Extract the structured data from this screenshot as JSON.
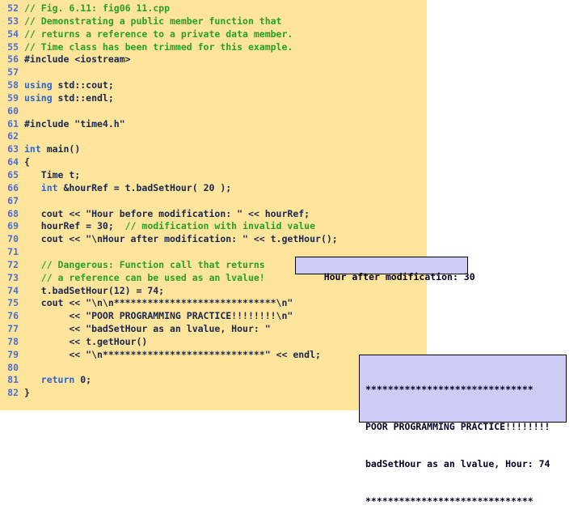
{
  "window": {
    "title": "C++ Code Listing - fig06_11.cpp",
    "background_color": "#ffffff"
  },
  "code_panel": {
    "background_color": "#ffe49b",
    "line_number_color": "#4a6fd4",
    "comment_color": "#27a122",
    "keyword_color": "#2b63d9",
    "plain_color": "#17264f",
    "first_line_number": 52,
    "last_line_number": 82,
    "lines": [
      {
        "n": "52",
        "segs": [
          {
            "t": "// Fig. 6.11: fig06 11.cpp",
            "c": "cm"
          }
        ]
      },
      {
        "n": "53",
        "segs": [
          {
            "t": "// Demonstrating a public member function that",
            "c": "cm"
          }
        ]
      },
      {
        "n": "54",
        "segs": [
          {
            "t": "// returns a reference to a private data member.",
            "c": "cm"
          }
        ]
      },
      {
        "n": "55",
        "segs": [
          {
            "t": "// Time class has been trimmed for this example.",
            "c": "cm"
          }
        ]
      },
      {
        "n": "56",
        "segs": [
          {
            "t": "#include <iostream>",
            "c": "pl"
          }
        ]
      },
      {
        "n": "57",
        "segs": [
          {
            "t": "",
            "c": "pl"
          }
        ]
      },
      {
        "n": "58",
        "segs": [
          {
            "t": "using",
            "c": "kw"
          },
          {
            "t": " std::cout;",
            "c": "pl"
          }
        ]
      },
      {
        "n": "59",
        "segs": [
          {
            "t": "using",
            "c": "kw"
          },
          {
            "t": " std::endl;",
            "c": "pl"
          }
        ]
      },
      {
        "n": "60",
        "segs": [
          {
            "t": "",
            "c": "pl"
          }
        ]
      },
      {
        "n": "61",
        "segs": [
          {
            "t": "#include \"time4.h\"",
            "c": "pl"
          }
        ]
      },
      {
        "n": "62",
        "segs": [
          {
            "t": "",
            "c": "pl"
          }
        ]
      },
      {
        "n": "63",
        "segs": [
          {
            "t": "int",
            "c": "kw"
          },
          {
            "t": " main()",
            "c": "pl"
          }
        ]
      },
      {
        "n": "64",
        "segs": [
          {
            "t": "{",
            "c": "pl"
          }
        ]
      },
      {
        "n": "65",
        "segs": [
          {
            "t": "   Time t;",
            "c": "pl"
          }
        ]
      },
      {
        "n": "66",
        "segs": [
          {
            "t": "   ",
            "c": "pl"
          },
          {
            "t": "int",
            "c": "kw"
          },
          {
            "t": " &hourRef = t.badSetHour( 20 );",
            "c": "pl"
          }
        ]
      },
      {
        "n": "67",
        "segs": [
          {
            "t": "",
            "c": "pl"
          }
        ]
      },
      {
        "n": "68",
        "segs": [
          {
            "t": "   cout << \"Hour before modification: \" << hourRef;",
            "c": "pl"
          }
        ]
      },
      {
        "n": "69",
        "segs": [
          {
            "t": "   hourRef = 30;  ",
            "c": "pl"
          },
          {
            "t": "// modification with invalid value",
            "c": "cm"
          }
        ]
      },
      {
        "n": "70",
        "segs": [
          {
            "t": "   cout << \"\\nHour after modification: \" << t.getHour();",
            "c": "pl"
          }
        ]
      },
      {
        "n": "71",
        "segs": [
          {
            "t": "",
            "c": "pl"
          }
        ]
      },
      {
        "n": "72",
        "segs": [
          {
            "t": "   ",
            "c": "pl"
          },
          {
            "t": "// Dangerous: Function call that returns",
            "c": "cm"
          }
        ]
      },
      {
        "n": "73",
        "segs": [
          {
            "t": "   ",
            "c": "pl"
          },
          {
            "t": "// a reference can be used as an lvalue!",
            "c": "cm"
          }
        ]
      },
      {
        "n": "74",
        "segs": [
          {
            "t": "   t.badSetHour(12) = 74;",
            "c": "pl"
          }
        ]
      },
      {
        "n": "75",
        "segs": [
          {
            "t": "   cout << \"\\n\\n*****************************\\n\"",
            "c": "pl"
          }
        ]
      },
      {
        "n": "76",
        "segs": [
          {
            "t": "        << \"POOR PROGRAMMING PRACTICE!!!!!!!!\\n\"",
            "c": "pl"
          }
        ]
      },
      {
        "n": "77",
        "segs": [
          {
            "t": "        << \"badSetHour as an lvalue, Hour: \"",
            "c": "pl"
          }
        ]
      },
      {
        "n": "78",
        "segs": [
          {
            "t": "        << t.getHour()",
            "c": "pl"
          }
        ]
      },
      {
        "n": "79",
        "segs": [
          {
            "t": "        << \"\\n*****************************\" << endl;",
            "c": "pl"
          }
        ]
      },
      {
        "n": "80",
        "segs": [
          {
            "t": "",
            "c": "pl"
          }
        ]
      },
      {
        "n": "81",
        "segs": [
          {
            "t": "   ",
            "c": "pl"
          },
          {
            "t": "return",
            "c": "kw"
          },
          {
            "t": " 0;",
            "c": "pl"
          }
        ]
      },
      {
        "n": "82",
        "segs": [
          {
            "t": "}",
            "c": "pl"
          }
        ]
      }
    ]
  },
  "output_box_1": {
    "background_color": "#ccccf5",
    "border_color": "#000000",
    "text": "Hour after modification: 30"
  },
  "output_box_2": {
    "background_color": "#ccccf5",
    "border_color": "#000000",
    "lines": [
      "******************************",
      "POOR PROGRAMMING PRACTICE!!!!!!!!",
      "badSetHour as an lvalue, Hour: 74",
      "******************************"
    ]
  }
}
